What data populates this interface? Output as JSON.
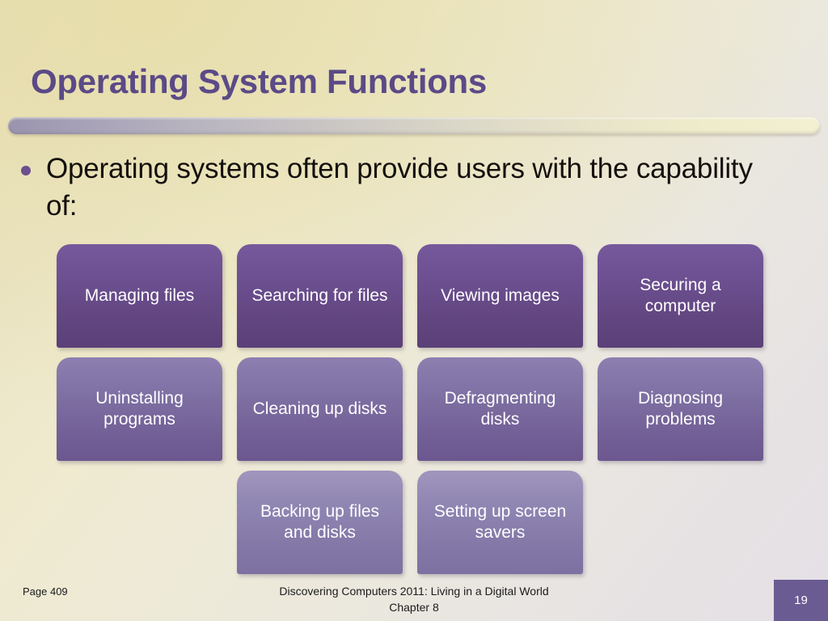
{
  "slide": {
    "title": "Operating System Functions",
    "bullet": "Operating systems often provide users with the capability of:",
    "colors": {
      "title_purple": "#5b4a86",
      "box_row1": "#6e5193",
      "box_row2": "#8174a6",
      "box_row3": "#9288b4",
      "badge_purple": "#6b5b93",
      "bullet_dot": "#6b4f8f"
    },
    "boxes": [
      [
        {
          "label": "Managing files"
        },
        {
          "label": "Searching for files"
        },
        {
          "label": "Viewing images"
        },
        {
          "label": "Securing a computer"
        }
      ],
      [
        {
          "label": "Uninstalling programs"
        },
        {
          "label": "Cleaning up disks"
        },
        {
          "label": "Defragmenting disks"
        },
        {
          "label": "Diagnosing problems"
        }
      ],
      [
        {
          "label": ""
        },
        {
          "label": "Backing up files and disks"
        },
        {
          "label": "Setting up screen savers"
        },
        {
          "label": ""
        }
      ]
    ],
    "footer": {
      "page_reference": "Page 409",
      "source_line1": "Discovering Computers 2011: Living in a Digital World",
      "source_line2": "Chapter 8",
      "slide_number": "19"
    }
  }
}
